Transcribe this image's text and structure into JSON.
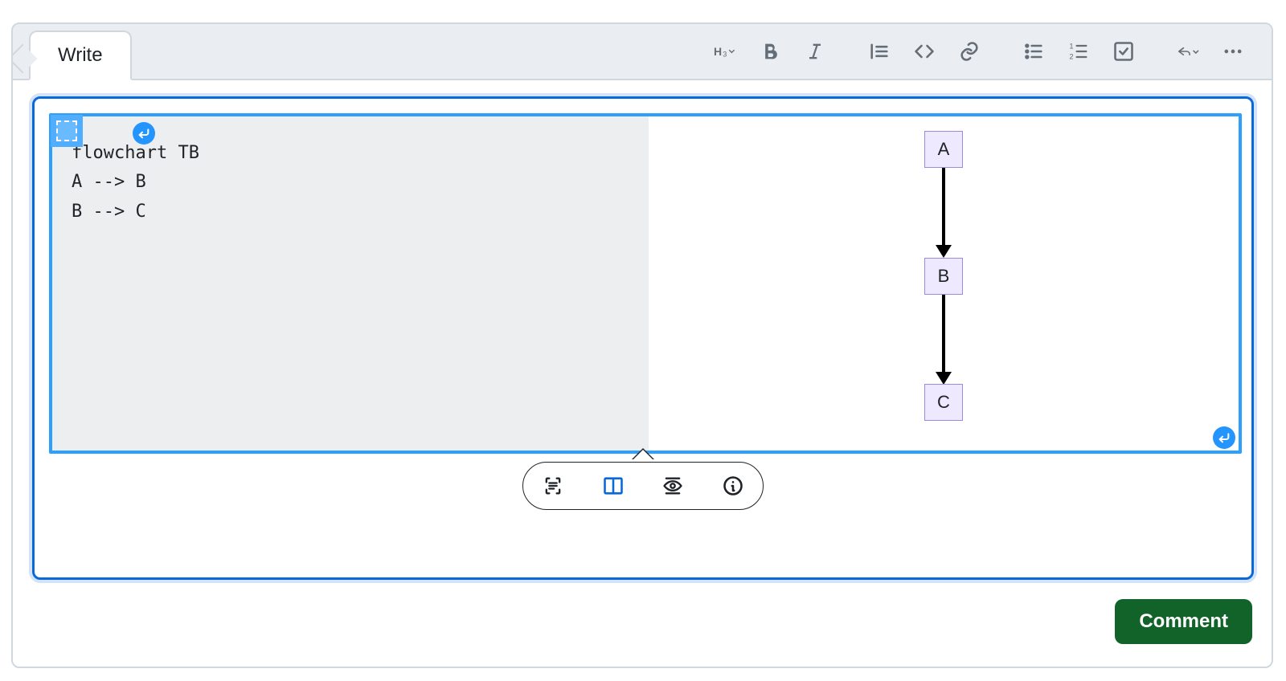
{
  "tabs": {
    "write": "Write"
  },
  "toolbar": {
    "heading_label": "H3"
  },
  "mermaid": {
    "code_lines": [
      "flowchart TB",
      "A --> B",
      "B --> C"
    ],
    "nodes": {
      "a": "A",
      "b": "B",
      "c": "C"
    }
  },
  "actions": {
    "comment": "Comment"
  }
}
